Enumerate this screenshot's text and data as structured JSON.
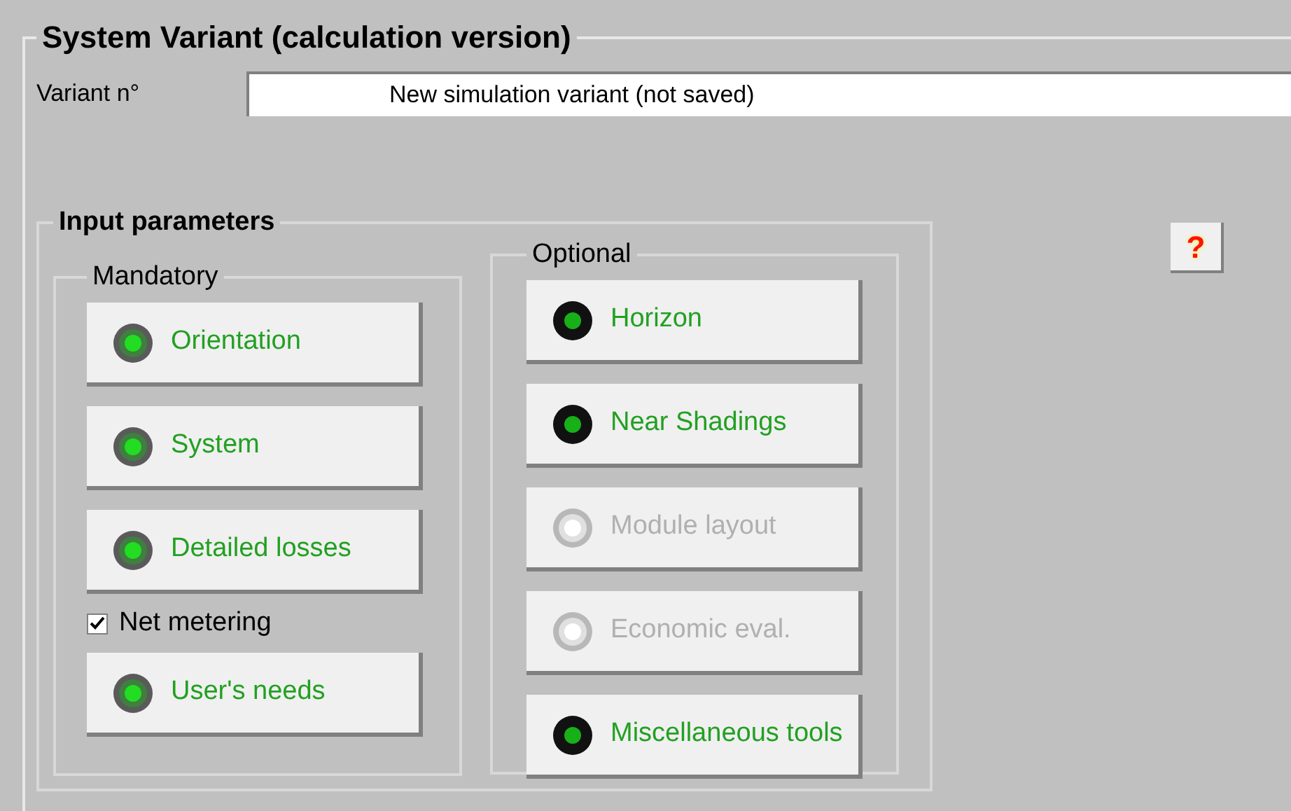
{
  "title": "System Variant (calculation version)",
  "variant": {
    "label": "Variant n°",
    "value": "New simulation variant (not saved)"
  },
  "input_parameters": {
    "title": "Input parameters",
    "mandatory": {
      "title": "Mandatory",
      "items": [
        {
          "kind": "button",
          "label": "Orientation",
          "lit": true,
          "disabled": false
        },
        {
          "kind": "button",
          "label": "System",
          "lit": true,
          "disabled": false
        },
        {
          "kind": "button",
          "label": "Detailed losses",
          "lit": true,
          "disabled": false
        },
        {
          "kind": "checkbox",
          "label": "Net metering",
          "checked": true
        },
        {
          "kind": "button",
          "label": "User's needs",
          "lit": true,
          "disabled": false
        }
      ]
    },
    "optional": {
      "title": "Optional",
      "items": [
        {
          "kind": "button",
          "label": "Horizon",
          "lit": true,
          "disabled": false
        },
        {
          "kind": "button",
          "label": "Near Shadings",
          "lit": true,
          "disabled": false
        },
        {
          "kind": "button",
          "label": "Module layout",
          "lit": false,
          "disabled": true
        },
        {
          "kind": "button",
          "label": "Economic eval.",
          "lit": false,
          "disabled": true
        },
        {
          "kind": "button",
          "label": "Miscellaneous tools",
          "lit": true,
          "disabled": false
        }
      ]
    }
  },
  "help_button": "?"
}
